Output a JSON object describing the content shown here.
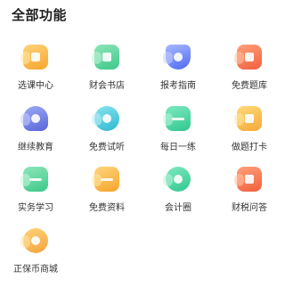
{
  "header": {
    "title": "全部功能"
  },
  "features": [
    {
      "label": "选课中心",
      "icon": "course-center-icon",
      "color": "orange"
    },
    {
      "label": "财会书店",
      "icon": "bookstore-icon",
      "color": "green"
    },
    {
      "label": "报考指南",
      "icon": "exam-guide-icon",
      "color": "blue"
    },
    {
      "label": "免费题库",
      "icon": "question-bank-icon",
      "color": "red"
    },
    {
      "label": "继续教育",
      "icon": "graduation-cap-icon",
      "color": "indigo"
    },
    {
      "label": "免费试听",
      "icon": "free-listen-icon",
      "color": "teal"
    },
    {
      "label": "每日一练",
      "icon": "daily-practice-icon",
      "color": "mint"
    },
    {
      "label": "做题打卡",
      "icon": "calendar-checkin-icon",
      "color": "amber"
    },
    {
      "label": "实务学习",
      "icon": "practice-study-icon",
      "color": "green"
    },
    {
      "label": "免费资料",
      "icon": "folder-icon",
      "color": "orange"
    },
    {
      "label": "会计圈",
      "icon": "accounting-circle-icon",
      "color": "green"
    },
    {
      "label": "财税问答",
      "icon": "qa-chat-icon",
      "color": "red"
    },
    {
      "label": "正保币商城",
      "icon": "coin-mall-icon",
      "color": "gold"
    }
  ]
}
